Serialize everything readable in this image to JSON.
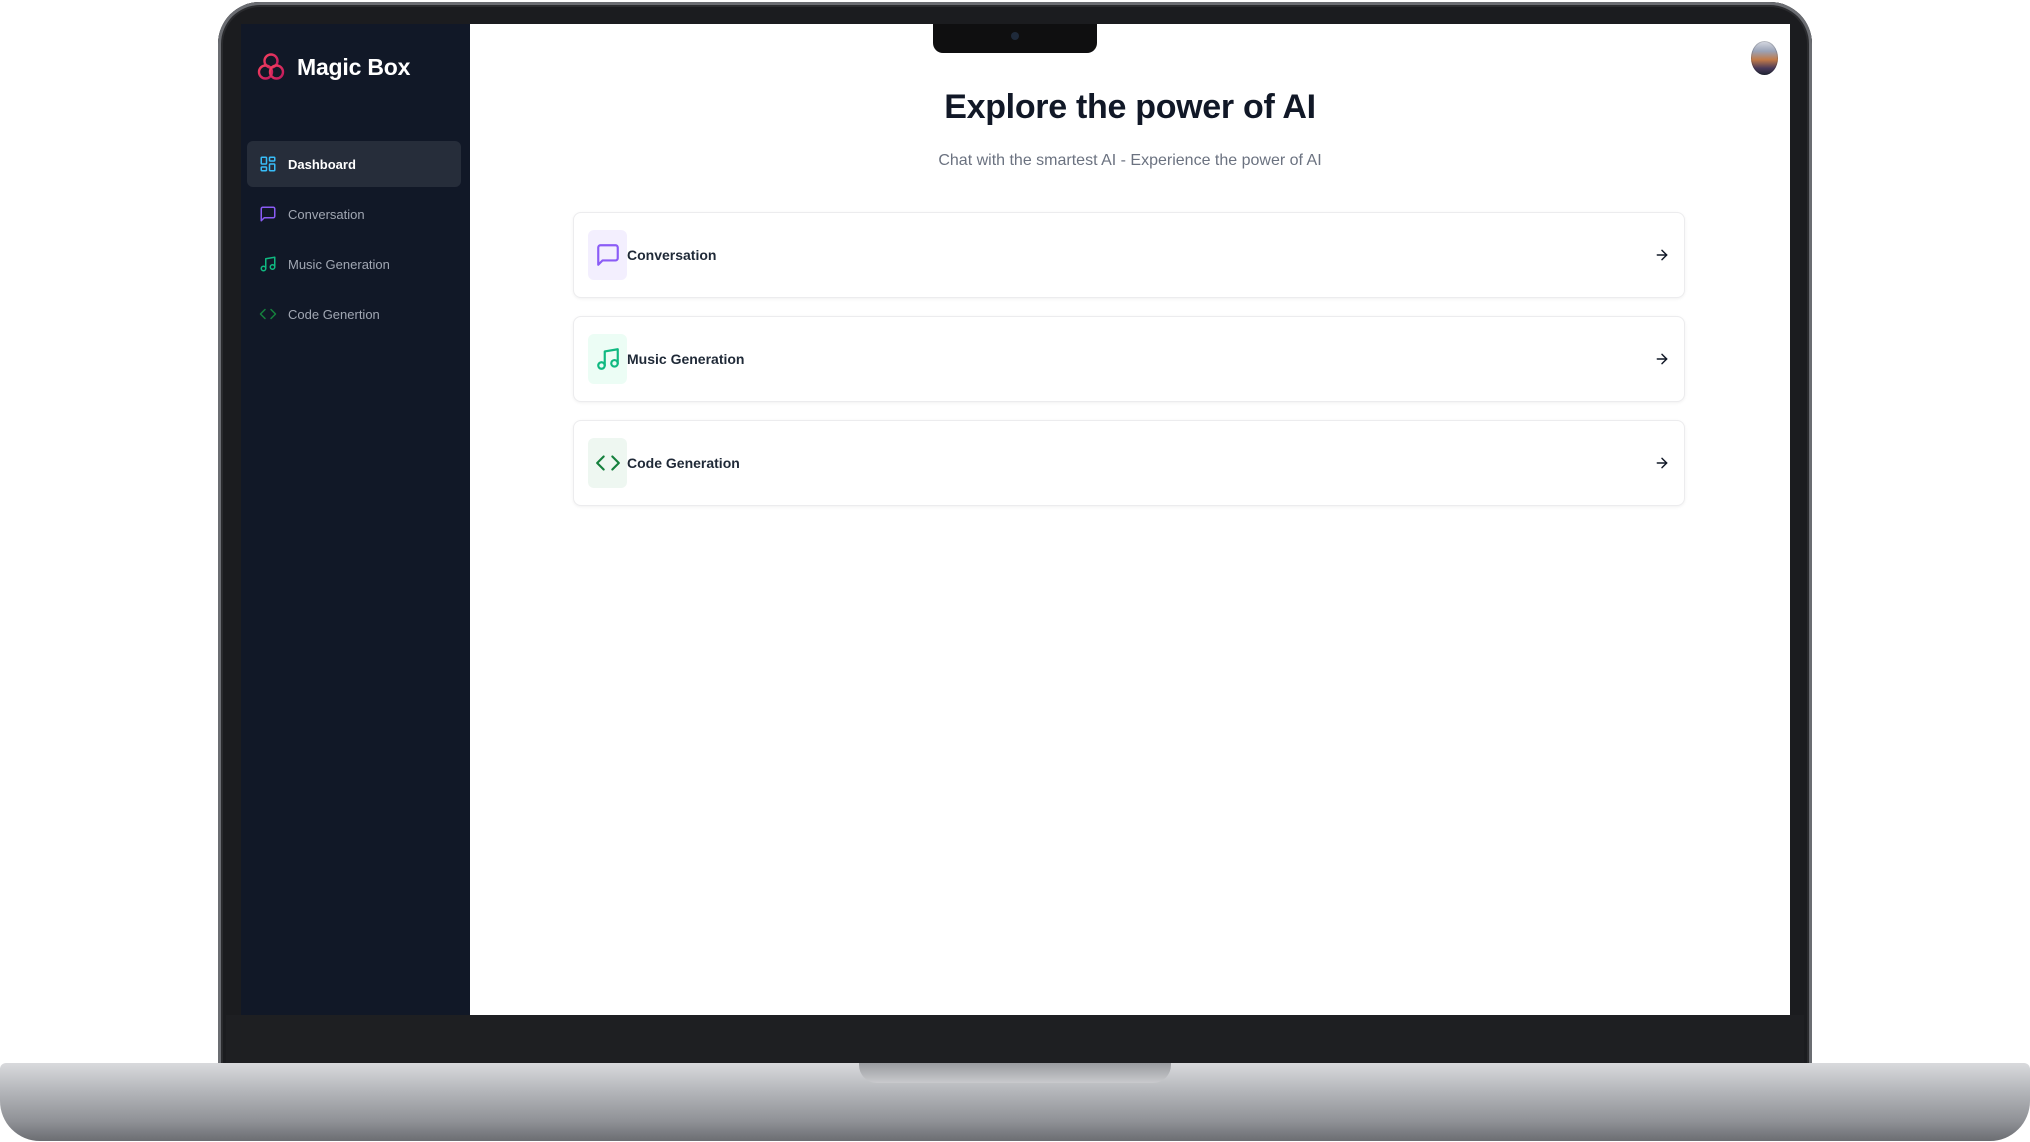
{
  "app": {
    "name": "Magic Box"
  },
  "sidebar": {
    "items": [
      {
        "label": "Dashboard",
        "icon": "layout-dashboard-icon",
        "color": "#38bdf8",
        "active": true
      },
      {
        "label": "Conversation",
        "icon": "message-square-icon",
        "color": "#8b5cf6",
        "active": false
      },
      {
        "label": "Music Generation",
        "icon": "music-icon",
        "color": "#10b981",
        "active": false
      },
      {
        "label": "Code Genertion",
        "icon": "code-icon",
        "color": "#15803d",
        "active": false
      }
    ]
  },
  "main": {
    "title": "Explore the power of AI",
    "subtitle": "Chat with the smartest AI - Experience the power of AI",
    "cards": [
      {
        "label": "Conversation",
        "icon": "message-square-icon",
        "color": "#8b5cf6",
        "bg": "#f3effe"
      },
      {
        "label": "Music Generation",
        "icon": "music-icon",
        "color": "#10b981",
        "bg": "#ecfdf5"
      },
      {
        "label": "Code Generation",
        "icon": "code-icon",
        "color": "#15803d",
        "bg": "#eef7f1"
      }
    ]
  },
  "colors": {
    "sidebar_bg": "#111827",
    "active_item_bg": "#262d3a",
    "brand_logo": "#e0245e"
  }
}
